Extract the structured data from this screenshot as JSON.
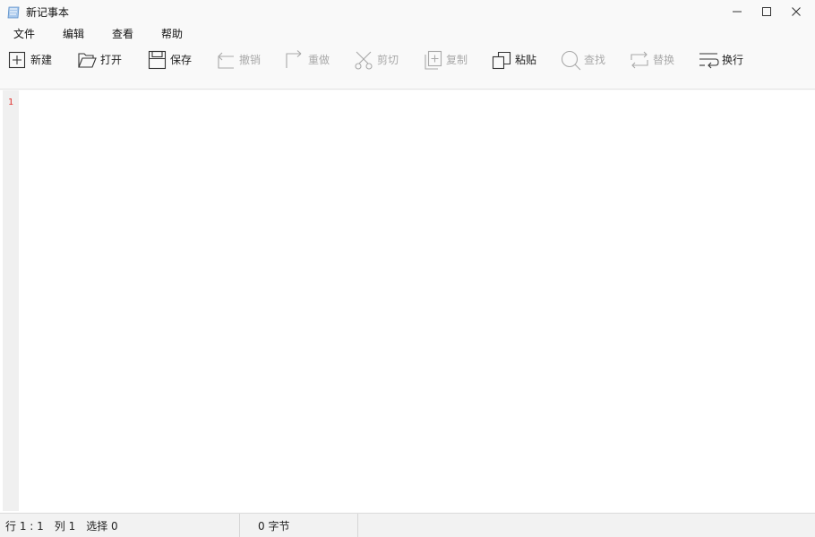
{
  "window": {
    "title": "新记事本"
  },
  "menu": {
    "items": [
      "文件",
      "编辑",
      "查看",
      "帮助"
    ]
  },
  "toolbar": {
    "items": [
      {
        "label": "新建",
        "icon": "new-file-icon",
        "enabled": true
      },
      {
        "label": "打开",
        "icon": "folder-open-icon",
        "enabled": true
      },
      {
        "label": "保存",
        "icon": "save-icon",
        "enabled": true
      },
      {
        "label": "撤销",
        "icon": "undo-icon",
        "enabled": false
      },
      {
        "label": "重做",
        "icon": "redo-icon",
        "enabled": false
      },
      {
        "label": "剪切",
        "icon": "scissors-icon",
        "enabled": false
      },
      {
        "label": "复制",
        "icon": "copy-icon",
        "enabled": false
      },
      {
        "label": "粘贴",
        "icon": "paste-icon",
        "enabled": true
      },
      {
        "label": "查找",
        "icon": "search-icon",
        "enabled": false
      },
      {
        "label": "替换",
        "icon": "replace-icon",
        "enabled": false
      },
      {
        "label": "换行",
        "icon": "word-wrap-icon",
        "enabled": true
      }
    ]
  },
  "editor": {
    "line_number": "1",
    "content": ""
  },
  "status": {
    "row": "行 1 : 1",
    "col": "列 1",
    "selection": "选择 0",
    "bytes": "0 字节"
  },
  "colors": {
    "line_number": "#e0322f",
    "enabled_text": "#222222",
    "disabled_text": "#a9a9a9"
  }
}
